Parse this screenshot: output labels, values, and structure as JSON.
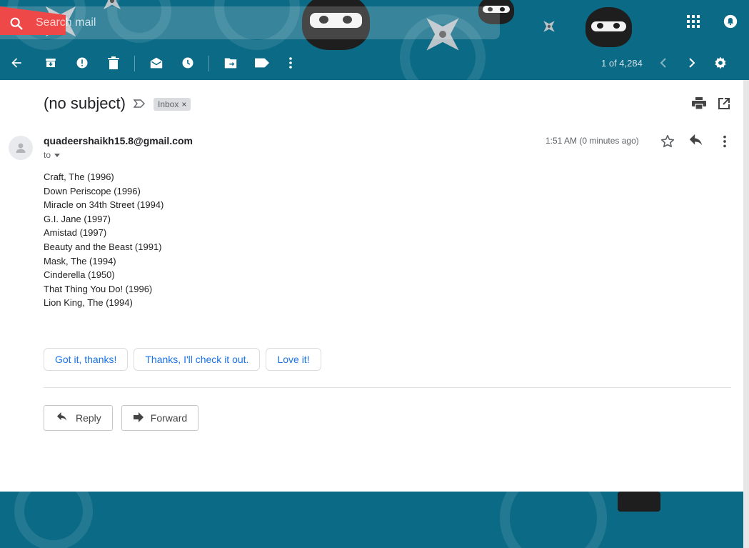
{
  "search": {
    "placeholder": "Search mail"
  },
  "toolbar": {
    "pager_text": "1 of 4,284"
  },
  "email": {
    "subject": "(no subject)",
    "label": "Inbox",
    "label_remove": "×",
    "sender": "quadeershaikh15.8@gmail.com",
    "to_text": "to",
    "time": "1:51 AM (0 minutes ago)",
    "body_lines": [
      "Craft, The (1996)",
      "Down Periscope (1996)",
      "Miracle on 34th Street (1994)",
      "G.I. Jane (1997)",
      "Amistad (1997)",
      "Beauty and the Beast (1991)",
      "Mask, The (1994)",
      "Cinderella (1950)",
      "That Thing You Do! (1996)",
      "Lion King, The (1994)"
    ]
  },
  "smart_replies": [
    "Got it, thanks!",
    "Thanks, I'll check it out.",
    "Love it!"
  ],
  "actions": {
    "reply": "Reply",
    "forward": "Forward"
  },
  "colors": {
    "theme_bg": "#0b6a86",
    "accent_blue": "#1a73e8",
    "search_red": "#ef4848"
  },
  "icons": {
    "top_right": [
      "apps-grid-icon",
      "notifications-icon"
    ],
    "toolbar": [
      "back-arrow-icon",
      "archive-icon",
      "report-spam-icon",
      "delete-icon",
      "mark-unread-icon",
      "snooze-icon",
      "move-to-icon",
      "labels-icon",
      "more-vert-icon",
      "prev-page-icon",
      "next-page-icon",
      "settings-gear-icon"
    ]
  }
}
